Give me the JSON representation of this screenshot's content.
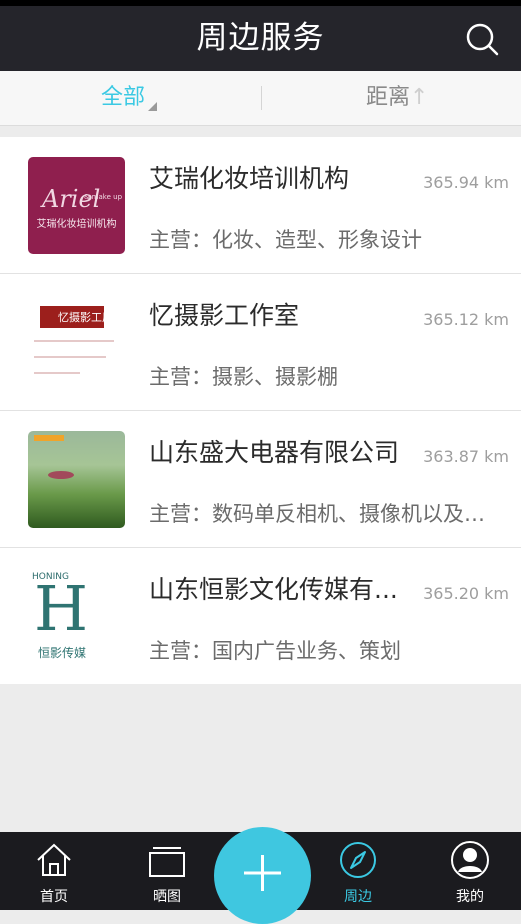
{
  "header": {
    "title": "周边服务",
    "search_icon": "search-icon"
  },
  "filters": {
    "all_label": "全部",
    "distance_label": "距离",
    "distance_suffix": "↑"
  },
  "items": [
    {
      "name": "艾瑞化妆培训机构",
      "distance": "365.94 km",
      "desc": "主营：化妆、造型、形象设计",
      "logo_script": "Ariel",
      "logo_sub": "& make up",
      "logo_text": "艾瑞化妆培训机构"
    },
    {
      "name": "忆摄影工作室",
      "distance": "365.12 km",
      "desc": "主营：摄影、摄影棚",
      "logo_text": "忆摄影工厂"
    },
    {
      "name": "山东盛大电器有限公司",
      "distance": "363.87 km",
      "desc": "主营：数码单反相机、摄像机以及…"
    },
    {
      "name": "山东恒影文化传媒有...",
      "distance": "365.20 km",
      "desc": "主营：国内广告业务、策划",
      "logo_brand": "HONING",
      "logo_text": "恒影传媒"
    }
  ],
  "tabbar": {
    "items": [
      {
        "label": "首页",
        "icon": "home-icon"
      },
      {
        "label": "晒图",
        "icon": "gallery-icon"
      },
      {
        "label": "周边",
        "icon": "compass-icon"
      },
      {
        "label": "我的",
        "icon": "profile-icon"
      }
    ],
    "fab_icon": "plus-icon"
  },
  "colors": {
    "accent": "#3bc9e3",
    "header_bg": "#25252b",
    "tabbar_bg": "#1b1b1f"
  }
}
